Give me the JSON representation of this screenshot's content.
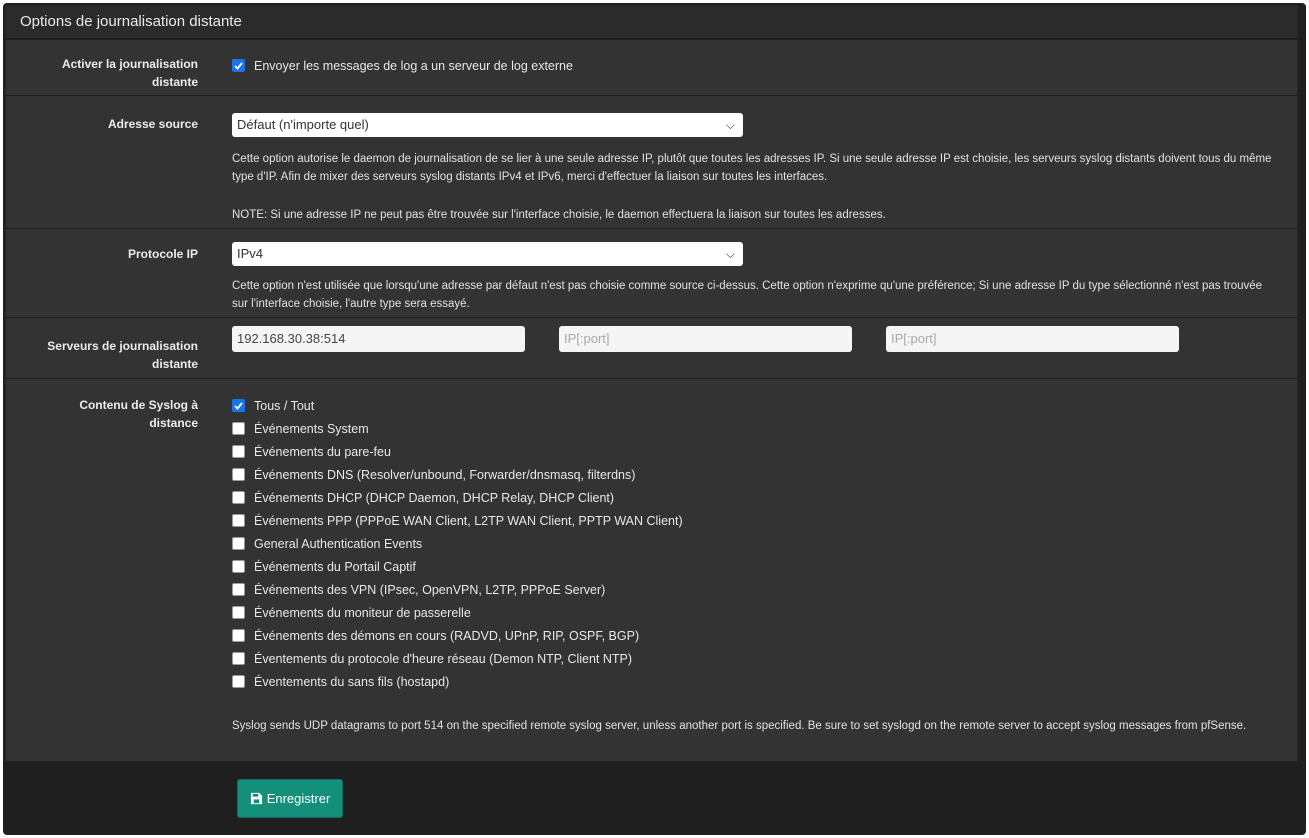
{
  "panel": {
    "title": "Options de journalisation distante"
  },
  "enable": {
    "label": "Activer la journalisation distante",
    "checkbox_label": "Envoyer les messages de log a un serveur de log externe",
    "checked": true
  },
  "source": {
    "label": "Adresse source",
    "selected": "Défaut (n'importe quel)",
    "help1": "Cette option autorise le daemon de journalisation de se lier à une seule adresse IP, plutôt que toutes les adresses IP. Si une seule adresse IP est choisie, les serveurs syslog distants doivent tous du même type d'IP. Afin de mixer des serveurs syslog distants IPv4 et IPv6, merci d'effectuer la liaison sur toutes les interfaces.",
    "help2": "NOTE: Si une adresse IP ne peut pas être trouvée sur l'interface choisie, le daemon effectuera la liaison sur toutes les adresses."
  },
  "protocol": {
    "label": "Protocole IP",
    "selected": "IPv4",
    "help": "Cette option n'est utilisée que lorsqu'une adresse par défaut n'est pas choisie comme source ci-dessus. Cette option n'exprime qu'une préférence; Si une adresse IP du type sélectionné n'est pas trouvée sur l'interface choisie, l'autre type sera essayé."
  },
  "servers": {
    "label": "Serveurs de journalisation distante",
    "server1_value": "192.168.30.38:514",
    "server2_placeholder": "IP[:port]",
    "server3_placeholder": "IP[:port]"
  },
  "syslog": {
    "label": "Contenu de Syslog à distance",
    "items": [
      {
        "label": "Tous / Tout",
        "checked": true
      },
      {
        "label": "Événements System",
        "checked": false
      },
      {
        "label": "Événements du pare-feu",
        "checked": false
      },
      {
        "label": "Événements DNS (Resolver/unbound, Forwarder/dnsmasq, filterdns)",
        "checked": false
      },
      {
        "label": "Événements DHCP (DHCP Daemon, DHCP Relay, DHCP Client)",
        "checked": false
      },
      {
        "label": "Événements PPP (PPPoE WAN Client, L2TP WAN Client, PPTP WAN Client)",
        "checked": false
      },
      {
        "label": "General Authentication Events",
        "checked": false
      },
      {
        "label": "Événements du Portail Captif",
        "checked": false
      },
      {
        "label": "Événements des VPN (IPsec, OpenVPN, L2TP, PPPoE Server)",
        "checked": false
      },
      {
        "label": "Événements du moniteur de passerelle",
        "checked": false
      },
      {
        "label": "Événements des démons en cours (RADVD, UPnP, RIP, OSPF, BGP)",
        "checked": false
      },
      {
        "label": "Éventements du protocole d'heure réseau (Demon NTP, Client NTP)",
        "checked": false
      },
      {
        "label": "Éventements du sans fils (hostapd)",
        "checked": false
      }
    ],
    "help": "Syslog sends UDP datagrams to port 514 on the specified remote syslog server, unless another port is specified. Be sure to set syslogd on the remote server to accept syslog messages from pfSense."
  },
  "save_button": {
    "label": "Enregistrer",
    "icon": "floppy-disk-icon",
    "color": "#14907a"
  },
  "colors": {
    "panel_bg": "#333333",
    "page_bg": "#1f1f1f",
    "checkbox_blue": "#1a73e8"
  }
}
